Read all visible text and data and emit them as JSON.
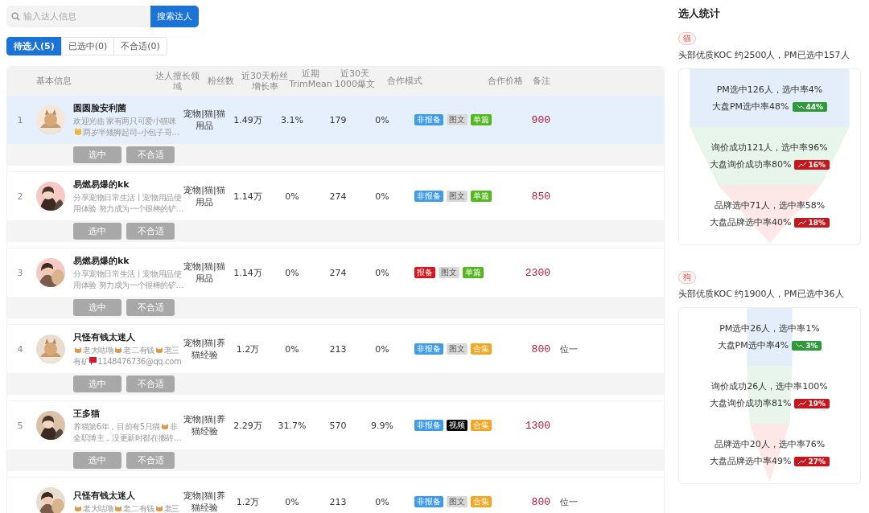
{
  "search": {
    "placeholder": "输入达人信息",
    "button": "搜索达人"
  },
  "tabs": [
    {
      "label": "待选人(5)",
      "selected": true
    },
    {
      "label": "已选中(0)",
      "selected": false
    },
    {
      "label": "不合适(0)",
      "selected": false
    }
  ],
  "table": {
    "columns": [
      "基本信息",
      "达人擅长领域",
      "粉丝数",
      "近30天粉丝增长率",
      "近期TrimMean",
      "近30天1000爆文",
      "合作模式",
      "合作价格",
      "备注"
    ],
    "rows": [
      {
        "index": "1",
        "highlighted": true,
        "avatar": {
          "kind": "picture"
        },
        "name": "圆圆脸安利菌",
        "bio": [
          [
            {
              "kind": "text",
              "text": "欢迎光临 家有两只可爱小猫咪"
            }
          ],
          [
            {
              "kind": "cat-face"
            },
            {
              "kind": "text",
              "text": "两岁半矮脚起司–小包子哥…"
            }
          ]
        ],
        "domain": "宠物|猫|猫用品",
        "fans": "1.49万",
        "growth": "3.1%",
        "trimmean": "179",
        "viral_rate": "0%",
        "tags": [
          {
            "label": "非报备",
            "color": "#3d9be9"
          },
          {
            "label": "图文",
            "color": "#d9d9d9"
          },
          {
            "label": "单篇",
            "color": "#52b81e"
          }
        ],
        "price": "900",
        "actions": [
          "选中",
          "不合适"
        ]
      },
      {
        "index": "2",
        "highlighted": false,
        "avatar": {
          "kind": "picture"
        },
        "name": "易燃易爆的kk",
        "bio": [
          [
            {
              "kind": "text",
              "text": "分享宠物日常生活丨宠物用品使"
            }
          ],
          [
            {
              "kind": "text",
              "text": "用体验 努力成为一个很棒的铲…"
            }
          ]
        ],
        "domain": "宠物|猫|猫用品",
        "fans": "1.14万",
        "growth": "0%",
        "trimmean": "274",
        "viral_rate": "0%",
        "tags": [
          {
            "label": "非报备",
            "color": "#3d9be9"
          },
          {
            "label": "图文",
            "color": "#d9d9d9"
          },
          {
            "label": "单篇",
            "color": "#52b81e"
          }
        ],
        "price": "850",
        "actions": [
          "选中",
          "不合适"
        ]
      },
      {
        "index": "3",
        "highlighted": false,
        "avatar": {
          "kind": "picture"
        },
        "name": "易燃易爆的kk",
        "bio": [
          [
            {
              "kind": "text",
              "text": "分享宠物日常生活丨宠物用品使"
            }
          ],
          [
            {
              "kind": "text",
              "text": "用体验 努力成为一个很棒的铲…"
            }
          ]
        ],
        "domain": "宠物|猫|猫用品",
        "fans": "1.14万",
        "growth": "0%",
        "trimmean": "274",
        "viral_rate": "0%",
        "tags": [
          {
            "label": "报备",
            "color": "#d9141c"
          },
          {
            "label": "图文",
            "color": "#d9d9d9"
          },
          {
            "label": "单篇",
            "color": "#52b81e"
          }
        ],
        "price": "2300",
        "actions": [
          "选中",
          "不合适"
        ]
      },
      {
        "index": "4",
        "highlighted": false,
        "avatar": {
          "kind": "picture"
        },
        "name": "只怪有钱太迷人",
        "bio": [
          [
            {
              "kind": "cat"
            },
            {
              "kind": "text",
              "text": "老大咕噜"
            },
            {
              "kind": "cat"
            },
            {
              "kind": "text",
              "text": "老二有钱"
            },
            {
              "kind": "cat"
            },
            {
              "kind": "text",
              "text": "老三"
            }
          ],
          [
            {
              "kind": "text",
              "text": "有矿"
            },
            {
              "kind": "mail"
            },
            {
              "kind": "text",
              "text": "1148476736@qq.com"
            }
          ]
        ],
        "domain": "宠物|猫|养猫经验",
        "fans": "1.2万",
        "growth": "0%",
        "trimmean": "213",
        "viral_rate": "0%",
        "tags": [
          {
            "label": "非报备",
            "color": "#3d9be9"
          },
          {
            "label": "图文",
            "color": "#d9d9d9"
          },
          {
            "label": "合集",
            "color": "#f5a623"
          }
        ],
        "price": "800",
        "remark": "位一",
        "actions": [
          "选中",
          "不合适"
        ]
      },
      {
        "index": "5",
        "highlighted": false,
        "avatar": {
          "kind": "picture"
        },
        "name": "王多猫",
        "bio": [
          [
            {
              "kind": "text",
              "text": "养猫第6年，目前有5只猫"
            },
            {
              "kind": "cat"
            },
            {
              "kind": "text",
              "text": "非"
            }
          ],
          [
            {
              "kind": "text",
              "text": "全职博主，没更新时都在搬砖…"
            }
          ]
        ],
        "domain": "宠物|猫|养猫经验",
        "fans": "2.29万",
        "growth": "31.7%",
        "trimmean": "570",
        "viral_rate": "9.9%",
        "tags": [
          {
            "label": "非报备",
            "color": "#3d9be9"
          },
          {
            "label": "视频",
            "color": "#000000"
          },
          {
            "label": "合集",
            "color": "#f5a623"
          }
        ],
        "price": "1300",
        "actions": [
          "选中",
          "不合适"
        ]
      },
      {
        "highlighted": false,
        "avatar": {
          "kind": "picture"
        },
        "name": "只怪有钱太迷人",
        "bio": [
          [
            {
              "kind": "cat"
            },
            {
              "kind": "text",
              "text": "老大咕噜"
            },
            {
              "kind": "cat"
            },
            {
              "kind": "text",
              "text": "老二有钱"
            },
            {
              "kind": "cat"
            },
            {
              "kind": "text",
              "text": "老三"
            }
          ]
        ],
        "domain": "宠物|猫|养猫经验",
        "fans": "1.2万",
        "growth": "0%",
        "trimmean": "213",
        "viral_rate": "0%",
        "tags": [
          {
            "label": "非报备",
            "color": "#3d9be9"
          },
          {
            "label": "图文",
            "color": "#d9d9d9"
          },
          {
            "label": "合集",
            "color": "#f5a623"
          }
        ],
        "price": "800",
        "remark": "位一"
      }
    ]
  },
  "stats": {
    "title": "选人统计",
    "groups": [
      {
        "tag": "猫",
        "kind": "wide",
        "summary": "头部优质KOC 约2500人，PM已选中157人",
        "stages": [
          {
            "line1": "PM选中126人，选中率4%",
            "line2": "大盘PM选中率48%",
            "trend": {
              "kind": "down",
              "value": "44%"
            },
            "color": "#e4eefb"
          },
          {
            "line1": "询价成功121人，选中率96%",
            "line2": "大盘询价成功率80%",
            "trend": {
              "kind": "up",
              "value": "16%"
            },
            "color": "#e8f5ea"
          },
          {
            "line1": "品牌选中71人，选中率58%",
            "line2": "大盘品牌选中率40%",
            "trend": {
              "kind": "up",
              "value": "18%"
            },
            "color": "#fde7e7"
          }
        ]
      },
      {
        "tag": "狗",
        "kind": "narrow",
        "summary": "头部优质KOC 约1900人，PM已选中36人",
        "stages": [
          {
            "line1": "PM选中26人，选中率1%",
            "line2": "大盘PM选中率4%",
            "trend": {
              "kind": "down",
              "value": "3%"
            },
            "color": "#e4eefb"
          },
          {
            "line1": "询价成功26人，选中率100%",
            "line2": "大盘询价成功率81%",
            "trend": {
              "kind": "up",
              "value": "19%"
            },
            "color": "#e8f5ea"
          },
          {
            "line1": "品牌选中20人，选中率76%",
            "line2": "大盘品牌选中率49%",
            "trend": {
              "kind": "up",
              "value": "27%"
            },
            "color": "#fde7e7"
          }
        ]
      }
    ]
  }
}
